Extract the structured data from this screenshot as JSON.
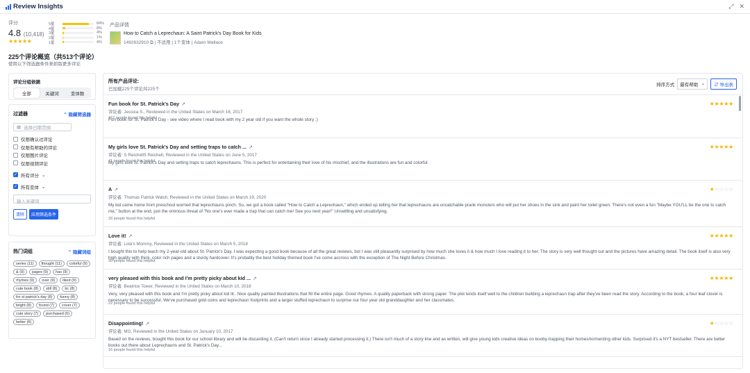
{
  "app": {
    "title": "Review Insights"
  },
  "summary": {
    "rating_label": "评分",
    "rating_value": "4.8",
    "rating_count": "(10,418)",
    "stars": "★★★★★",
    "distribution": [
      {
        "label": "5星",
        "pct_text": "84%",
        "pct": 84
      },
      {
        "label": "4星",
        "pct_text": "8%",
        "pct": 8
      },
      {
        "label": "3星",
        "pct_text": "4%",
        "pct": 4
      },
      {
        "label": "2星",
        "pct_text": "1%",
        "pct": 1
      },
      {
        "label": "1星",
        "pct_text": "4%",
        "pct": 4
      }
    ]
  },
  "product": {
    "heading": "产品详情",
    "title": "How to Catch a Leprechaun: A Saint Patrick's Day Book for Kids",
    "isbn": "1492632910",
    "copy_icon": "copy-icon",
    "applicable": "不适用",
    "variants": "1个变体",
    "author": "Adam Wallace"
  },
  "overview": {
    "title": "225个评论概览（共513个评论）",
    "subtitle": "使用以下筛选器条件来抓取更多评论"
  },
  "segment": {
    "label": "评论分组依据",
    "options": [
      "全部",
      "关键词",
      "变体数"
    ],
    "active": 0
  },
  "filters": {
    "title": "过滤器",
    "toggle": "隐藏筛选器",
    "date_placeholder": "选择日期范围",
    "checkboxes": [
      {
        "label": "仅限确认过评论",
        "checked": false
      },
      {
        "label": "仅限有帮助的评论",
        "checked": false
      },
      {
        "label": "仅限图片评论",
        "checked": false
      },
      {
        "label": "仅限视频评论",
        "checked": false
      }
    ],
    "all_ratings": "所有评分",
    "all_variants": "所有变体",
    "keyword_placeholder": "输入关键词",
    "clear": "清除",
    "apply": "应用筛选条件"
  },
  "hot_words": {
    "title": "热门词组",
    "toggle": "隐藏词组",
    "tags": [
      "series (11)",
      "thought (11)",
      "colorful (9)",
      "& (9)",
      "pages (9)",
      "has (9)",
      "rhymes (9)",
      "over (9)",
      "liked (9)",
      "cute book (8)",
      "still (8)",
      "bc (8)",
      "for st patrick's day (8)",
      "funny (8)",
      "bright (8)",
      "found (7)",
      "cover (7)",
      "cute story (7)",
      "purchased (6)",
      "better (6)"
    ]
  },
  "reviews_panel": {
    "title": "所有产品评论:",
    "subtitle": "已加载225个评论共225个",
    "sort_label": "排序方式",
    "sort_value": "最有帮助",
    "export": "导出表"
  },
  "reviews": [
    {
      "title": "Fun book for St. Patrick's Day",
      "meta": "评论者:   Jessica S., Reviewed in the United States on March 16, 2017",
      "body": "Fun book for St. Patrick's Day - see video where I read book with my 2 year old if you want the whole story :)",
      "helpful": "167 people found this helpful",
      "rating": 5
    },
    {
      "title": "My girls love St. Patrick's Day and setting traps to catch ...",
      "meta": "评论者:   S Reichelt5 Reichelt, Reviewed in the United States on June 5, 2017",
      "body": "My girls love St. Patrick's Day and setting traps to catch leprechauns. This is perfect for entertaining their love of his mischief, and the illustrations are fun and colorful.",
      "helpful": "41 people found this helpful",
      "rating": 5
    },
    {
      "title": "A",
      "meta": "评论者:   Thomas Patrick Walsh, Reviewed in the United States on March 19, 2020",
      "body": "My kid came home from preschool worried that leprechauns pinch. So, we got a book called \"How to Catch a Leprechaun,\" which ended up telling her that leprechauns are uncatchable prank monsters who will put her shoes in the sink and paint her toilet green. There's not even a fun \"Maybe YOU'LL be the one to catch me,\" button at the end, just the ominous threat of \"No one's ever made a trap that can catch me! See you next year!\" Unsettling and unsatisfying.",
      "helpful": "33 people found this helpful",
      "rating": 1
    },
    {
      "title": "Love it!",
      "meta": "评论者:   Lola's Mommy, Reviewed in the United States on March 5, 2018",
      "body": "I bought this to help teach my 2-year-old about St. Patrick's Day. I was expecting a good book because of all the great reviews, but I was still pleasantly surprised by how much she loves it & how much I love reading it to her. The story is very well thought out and the pictures have amazing detail. The book itself is also very high quality with thick, color rich pages and a sturdy hardcover. It's probably the best holiday themed book I've come accross with the exception of The Night Before Christmas.",
      "helpful": "30 people found this helpful",
      "rating": 5
    },
    {
      "title": "very pleased with this book and I'm pretty picky about kid ...",
      "meta": "评论者:   Beatrice Tower, Reviewed in the United States on March 10, 2018",
      "body": "Very, very pleased with this book and I'm pretty picky about kid lit.. Nice quality painted illustrations that fill the entire page. Good rhymes. A quality paperback with strong paper. The plot lends itself well to the children building a leprechaun trap after they've been read the story. According to the book, a four leaf clover is necessary to be successful. We've purchased gold coins and leprechaun footprints and a larger stuffed leprechaun to surprise our four year old granddaughter and her classmates.",
      "helpful": "22 people found this helpful",
      "rating": 5
    },
    {
      "title": "Disappointing!",
      "meta": "评论者:   MG, Reviewed in the United States on January 10, 2017",
      "body": "Based on the reviews, bought this book for our school library and will be discarding it. (Can't return since I already started processing it.) There isn't much of a story line and as written, will give young kids creative ideas on booby-trapping their homes/tormenting other kids. Surprised it's a NYT bestseller. There are better books out there about Leprechauns and St. Patrick's Day...",
      "helpful": "16 people found this helpful",
      "rating": 1
    }
  ],
  "colors": {
    "accent": "#2563eb",
    "star": "#f5b400"
  }
}
